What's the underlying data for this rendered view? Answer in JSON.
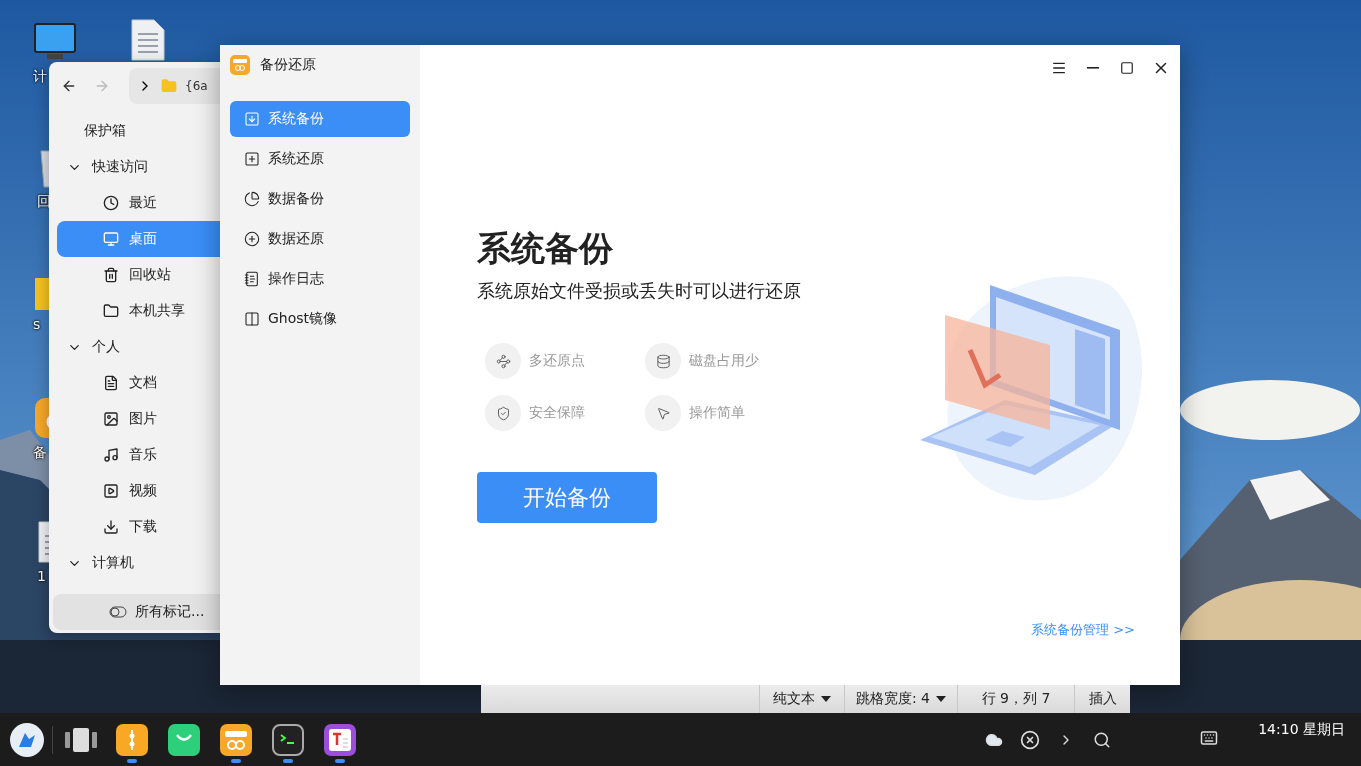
{
  "desktop": {
    "icons": [
      {
        "kind": "computer",
        "label": "计"
      },
      {
        "kind": "document"
      },
      {
        "kind": "trash",
        "label": "回"
      },
      {
        "kind": "folder",
        "label": "s"
      },
      {
        "kind": "backup",
        "label": "备"
      },
      {
        "kind": "document",
        "label": "1"
      }
    ]
  },
  "file_manager": {
    "path": "{6a",
    "sidebar": [
      {
        "label": "保护箱",
        "selected": false
      },
      {
        "label": "快速访问",
        "expanded": true,
        "children": [
          {
            "label": "最近",
            "selected": false
          },
          {
            "label": "桌面",
            "selected": true
          },
          {
            "label": "回收站",
            "selected": false
          },
          {
            "label": "本机共享",
            "selected": false
          }
        ]
      },
      {
        "label": "个人",
        "expanded": true,
        "children": [
          {
            "label": "文档",
            "selected": false
          },
          {
            "label": "图片",
            "selected": false
          },
          {
            "label": "音乐",
            "selected": false
          },
          {
            "label": "视频",
            "selected": false
          },
          {
            "label": "下载",
            "selected": false
          }
        ]
      },
      {
        "label": "计算机",
        "expanded": true
      }
    ],
    "tags_button": "所有标记..."
  },
  "backup_app": {
    "title": "备份还原",
    "nav": [
      {
        "label": "系统备份",
        "selected": true
      },
      {
        "label": "系统还原",
        "selected": false
      },
      {
        "label": "数据备份",
        "selected": false
      },
      {
        "label": "数据还原",
        "selected": false
      },
      {
        "label": "操作日志",
        "selected": false
      },
      {
        "label": "Ghost镜像",
        "selected": false
      }
    ],
    "heading": "系统备份",
    "subtitle": "系统原始文件受损或丢失时可以进行还原",
    "features": [
      "多还原点",
      "磁盘占用少",
      "安全保障",
      "操作简单"
    ],
    "start_button": "开始备份",
    "manage_link": "系统备份管理 >>"
  },
  "editor_status": [
    {
      "label": "纯文本",
      "dropdown": true
    },
    {
      "label": "跳格宽度: 4",
      "dropdown": true
    },
    {
      "label": "行 9，列 7",
      "dropdown": false
    },
    {
      "label": "插入",
      "dropdown": false
    }
  ],
  "taskbar": {
    "apps": [
      {
        "kind": "files",
        "running": true
      },
      {
        "kind": "store",
        "running": false
      },
      {
        "kind": "backup",
        "running": true
      },
      {
        "kind": "terminal",
        "running": true
      },
      {
        "kind": "editor",
        "running": true
      }
    ],
    "clock": "14:10 星期日"
  }
}
